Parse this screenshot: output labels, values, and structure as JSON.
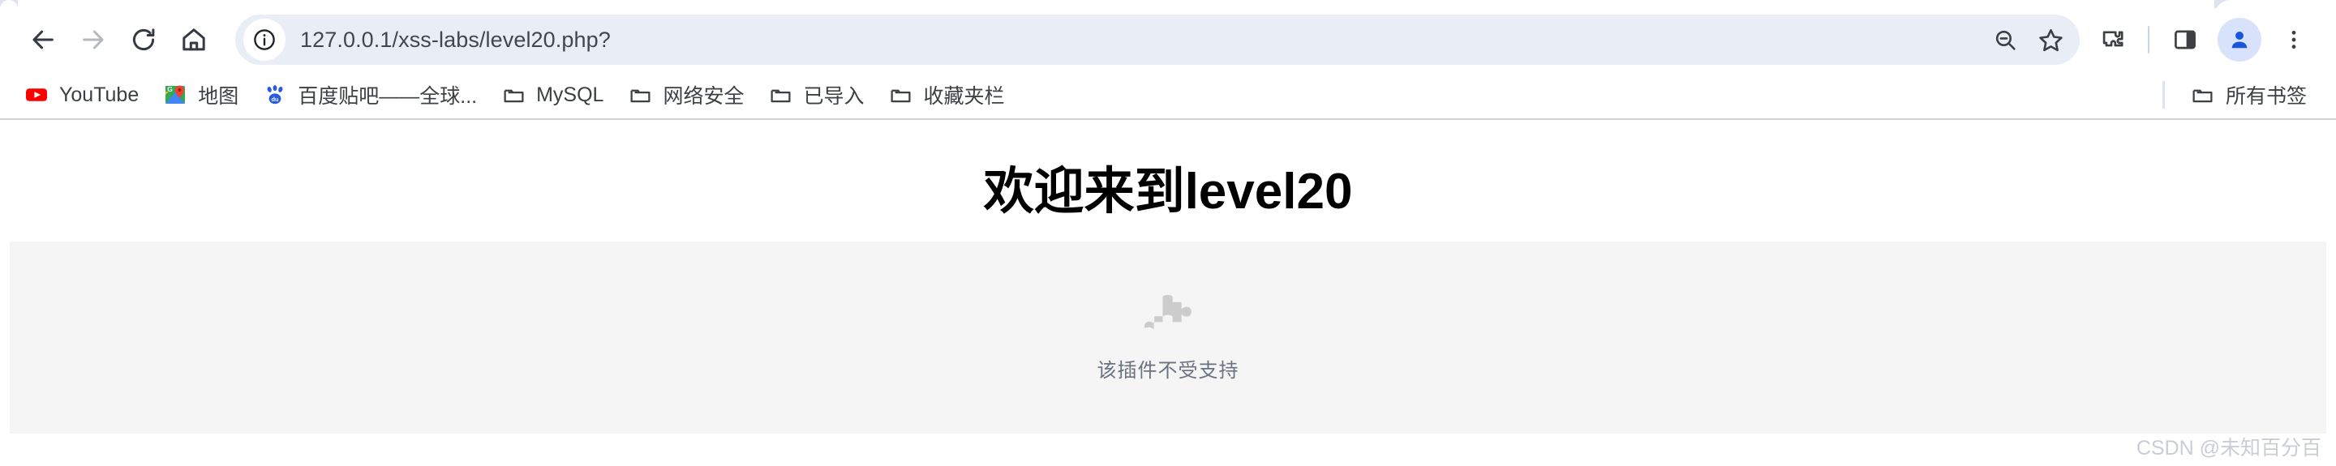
{
  "browser": {
    "nav": {
      "back": {
        "label": "Back",
        "icon": "arrow-left-icon",
        "enabled": true
      },
      "forward": {
        "label": "Forward",
        "icon": "arrow-right-icon",
        "enabled": false
      },
      "reload": {
        "label": "Reload",
        "icon": "reload-icon"
      },
      "home": {
        "label": "Home",
        "icon": "home-icon"
      }
    },
    "omnibox": {
      "url": "127.0.0.1/xss-labs/level20.php?",
      "placeholder": "Search Google or type a URL",
      "site_info_icon": "info-circle-icon",
      "zoom_out_icon": "zoom-out-icon",
      "bookmark_star_icon": "star-icon"
    },
    "toolbar_right": {
      "extensions_icon": "puzzle-icon",
      "side_panel_icon": "side-panel-icon",
      "profile_icon": "avatar-person-icon",
      "menu_icon": "three-dots-vertical-icon"
    },
    "bookmarks": {
      "items": [
        {
          "label": "YouTube",
          "icon": "youtube-icon"
        },
        {
          "label": "地图",
          "icon": "google-maps-icon"
        },
        {
          "label": "百度贴吧——全球...",
          "icon": "baidu-icon"
        },
        {
          "label": "MySQL",
          "icon": "folder-icon"
        },
        {
          "label": "网络安全",
          "icon": "folder-icon"
        },
        {
          "label": "已导入",
          "icon": "folder-icon"
        },
        {
          "label": "收藏夹栏",
          "icon": "folder-icon"
        }
      ],
      "all_bookmarks": {
        "label": "所有书签",
        "icon": "folder-icon"
      }
    }
  },
  "page": {
    "heading": "欢迎来到level20",
    "plugin": {
      "icon": "puzzle-piece-icon",
      "message": "该插件不受支持"
    },
    "watermark": "CSDN @未知百分百"
  },
  "colors": {
    "omnibox_bg": "#e9edf6",
    "avatar_bg": "#d9e2fb",
    "plugin_panel_bg": "#f5f5f5",
    "plugin_icon": "#cccccc",
    "youtube_red": "#ff0000",
    "baidu_blue": "#2a5ae0",
    "profile_blue": "#1a56db"
  }
}
